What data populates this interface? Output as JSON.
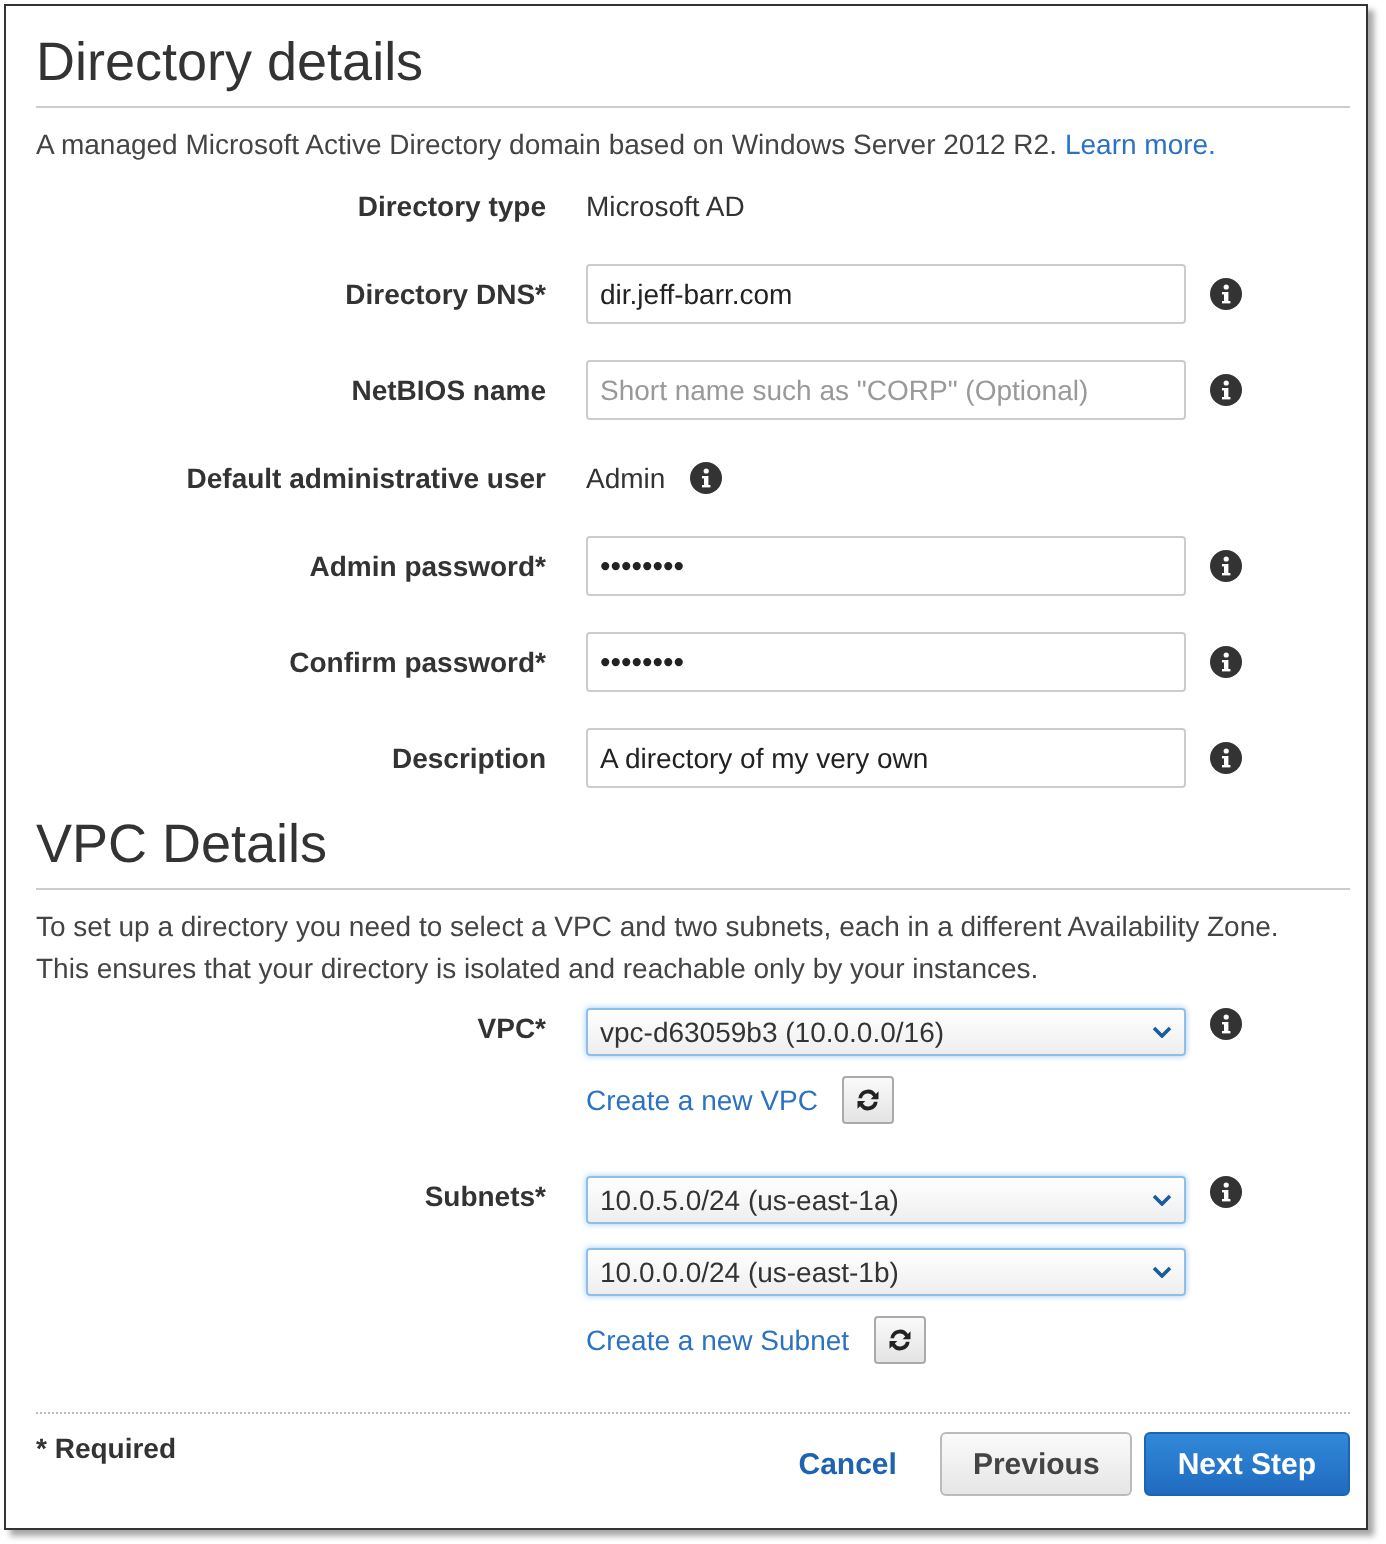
{
  "sections": [
    {
      "title": "Directory details",
      "intro": {
        "lines": [
          "A managed Microsoft Active Directory domain based on Windows Server 2012 R2."
        ],
        "link": "Learn more."
      },
      "fields": [
        {
          "label": "Directory type",
          "kind": "static",
          "value": "Microsoft AD",
          "info": false
        },
        {
          "label": "Directory DNS*",
          "kind": "input",
          "value": "dir.jeff-barr.com",
          "info": true
        },
        {
          "label": "NetBIOS name",
          "kind": "input",
          "placeholder": "Short name such as \"CORP\" (Optional)",
          "info": true
        },
        {
          "label": "Default administrative user",
          "kind": "static",
          "value": "Admin",
          "info": true
        },
        {
          "label": "Admin password*",
          "kind": "password",
          "value": "••••••••",
          "info": true
        },
        {
          "label": "Confirm password*",
          "kind": "password",
          "value": "••••••••",
          "info": true
        },
        {
          "label": "Description",
          "kind": "input",
          "value": "A directory of my very own",
          "info": true
        }
      ]
    },
    {
      "title": "VPC Details",
      "intro": {
        "lines": [
          "To set up a directory you need to select a VPC and two subnets, each in a different Availability Zone.",
          "This ensures that your directory is isolated and reachable only by your instances."
        ]
      },
      "fields": [
        {
          "label": "VPC*",
          "kind": "select",
          "selects": [
            "vpc-d63059b3 (10.0.0.0/16)"
          ],
          "link": "Create a new VPC",
          "info": true
        },
        {
          "label": "Subnets*",
          "kind": "select",
          "selects": [
            "10.0.5.0/24 (us-east-1a)",
            "10.0.0.0/24 (us-east-1b)"
          ],
          "link": "Create a new Subnet",
          "info": true
        }
      ]
    }
  ],
  "footer": {
    "note": "* Required",
    "buttons": [
      {
        "label": "Cancel",
        "kind": "link"
      },
      {
        "label": "Previous",
        "kind": "secondary"
      },
      {
        "label": "Next Step",
        "kind": "primary"
      }
    ]
  }
}
